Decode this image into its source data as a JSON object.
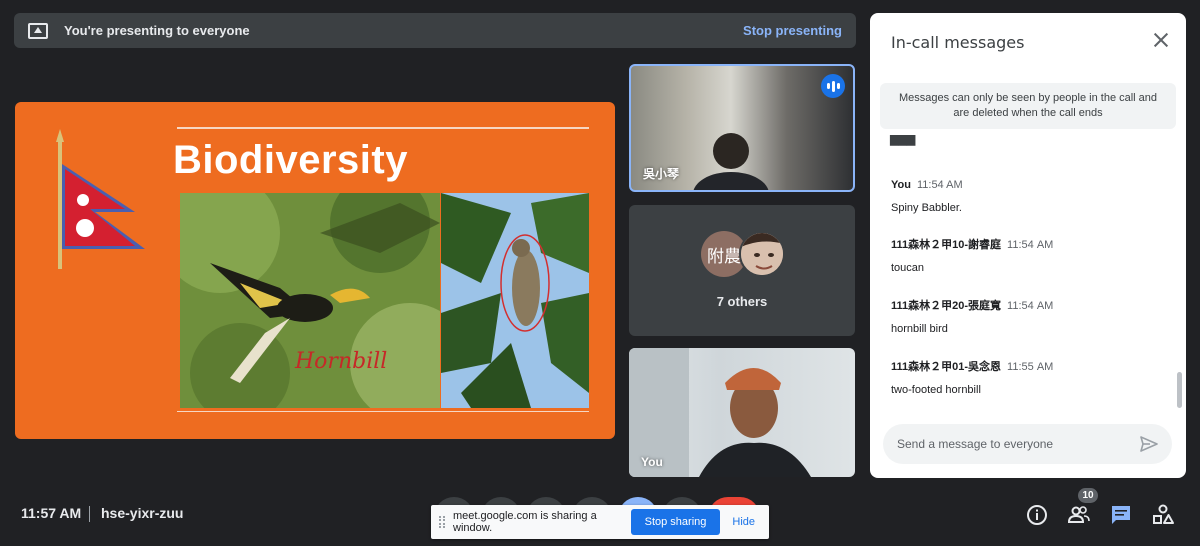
{
  "banner": {
    "text": "You're presenting to everyone",
    "stop_label": "Stop presenting"
  },
  "slide": {
    "title": "Biodiversity",
    "handwriting": "Hornbill"
  },
  "tiles": [
    {
      "name": "吳小琴"
    },
    {
      "avatar_text": "附農",
      "others_label": "7 others"
    },
    {
      "name": "You"
    }
  ],
  "chat": {
    "title": "In-call messages",
    "notice": "Messages can only be seen by people in the call and are deleted when the call ends",
    "messages": [
      {
        "sender": "You",
        "time": "11:54 AM",
        "text": "Spiny Babbler."
      },
      {
        "sender": "111森林２甲10-謝睿庭",
        "time": "11:54 AM",
        "text": "toucan"
      },
      {
        "sender": "111森林２甲20-張庭寬",
        "time": "11:54 AM",
        "text": "hornbill bird"
      },
      {
        "sender": "111森林２甲01-吳念恩",
        "time": "11:55 AM",
        "text": "two-footed hornbill"
      }
    ],
    "input_placeholder": "Send a message to everyone"
  },
  "bottom": {
    "time": "11:57 AM",
    "meeting_code": "hse-yixr-zuu",
    "people_count": "10"
  },
  "sharing": {
    "text": "meet.google.com is sharing a window.",
    "stop_label": "Stop sharing",
    "hide_label": "Hide"
  },
  "colors": {
    "accent": "#1a73e8",
    "link": "#8ab4f8",
    "slide_bg": "#ee6c20",
    "end_call": "#ea4335"
  }
}
